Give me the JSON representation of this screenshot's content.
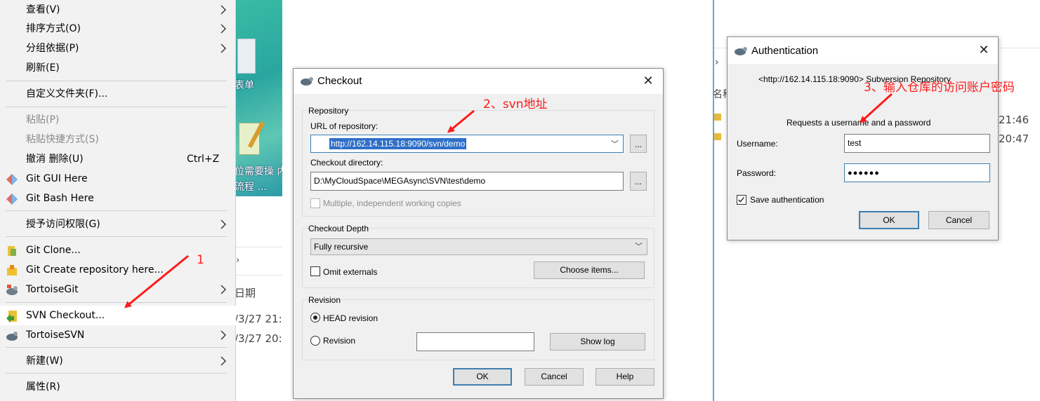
{
  "context_menu": {
    "items": [
      {
        "label": "查看(V)",
        "submenu": true
      },
      {
        "label": "排序方式(O)",
        "submenu": true
      },
      {
        "label": "分组依据(P)",
        "submenu": true
      },
      {
        "label": "刷新(E)"
      },
      {
        "label": "自定义文件夹(F)..."
      },
      {
        "label": "粘贴(P)",
        "disabled": true
      },
      {
        "label": "粘贴快捷方式(S)",
        "disabled": true
      },
      {
        "label": "撤消 删除(U)",
        "shortcut": "Ctrl+Z"
      },
      {
        "label": "Git GUI Here",
        "icon": "git-icon"
      },
      {
        "label": "Git Bash Here",
        "icon": "git-icon"
      },
      {
        "label": "授予访问权限(G)",
        "submenu": true
      },
      {
        "label": "Git Clone...",
        "icon": "git-clone-icon"
      },
      {
        "label": "Git Create repository here...",
        "icon": "git-create-repo-icon"
      },
      {
        "label": "TortoiseGit",
        "icon": "tortoisegit-icon",
        "submenu": true
      },
      {
        "label": "SVN Checkout...",
        "icon": "svn-checkout-icon",
        "highlighted": true
      },
      {
        "label": "TortoiseSVN",
        "icon": "tortoisesvn-icon",
        "submenu": true
      },
      {
        "label": "新建(W)",
        "submenu": true
      },
      {
        "label": "属性(R)"
      }
    ]
  },
  "background": {
    "desktop_labels": [
      "表单",
      "位需要操 内",
      "流程 ..."
    ],
    "explorer_column_header": "日期",
    "explorer_dates": [
      "/3/27 21:",
      "/3/27 20:"
    ],
    "right_header": "名称",
    "right_times": [
      "21:46",
      "20:47"
    ]
  },
  "checkout_dialog": {
    "title": "Checkout",
    "repository_group": "Repository",
    "url_label": "URL of repository:",
    "url_value": "http://162.14.115.18:9090/svn/demo",
    "browse_label": "...",
    "checkout_dir_label": "Checkout directory:",
    "checkout_dir_value": "D:\\MyCloudSpace\\MEGAsync\\SVN\\test\\demo",
    "multiple_copies_label": "Multiple, independent working copies",
    "depth_group": "Checkout Depth",
    "depth_value": "Fully recursive",
    "omit_externals_label": "Omit externals",
    "choose_items_label": "Choose items...",
    "revision_group": "Revision",
    "head_revision_label": "HEAD revision",
    "revision_label": "Revision",
    "revision_value": "",
    "show_log_label": "Show log",
    "ok_label": "OK",
    "cancel_label": "Cancel",
    "help_label": "Help"
  },
  "auth_dialog": {
    "title": "Authentication",
    "realm_text": "<http://162.14.115.18:9090> Subversion Repository",
    "request_text": "Requests a username and a password",
    "username_label": "Username:",
    "username_value": "test",
    "password_label": "Password:",
    "password_value": "●●●●●●",
    "save_auth_label": "Save authentication",
    "save_auth_checked": true,
    "ok_label": "OK",
    "cancel_label": "Cancel"
  },
  "annotations": {
    "step1": "1",
    "step2": "2、svn地址",
    "step3": "3、输入仓库的访问账户密码",
    "color": "#ff1a1a"
  }
}
